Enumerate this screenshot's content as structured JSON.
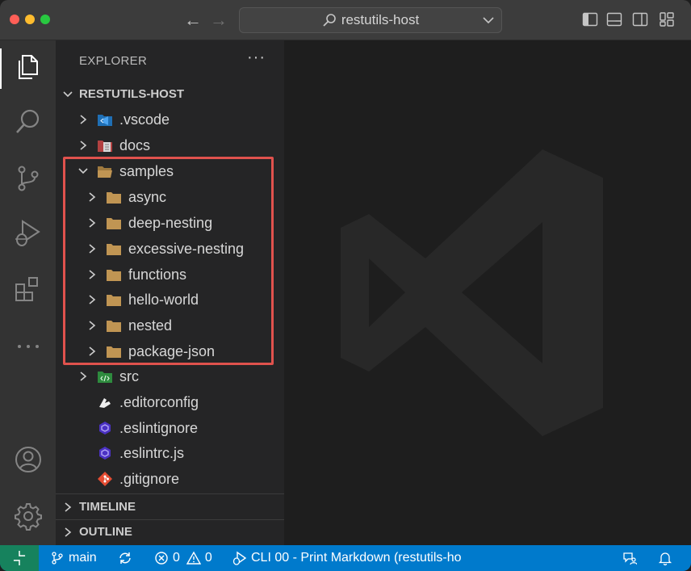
{
  "titlebar": {
    "search_label": "restutils-host"
  },
  "activity_bar": {
    "items": [
      "files-icon",
      "search-icon",
      "source-control-icon",
      "run-debug-icon",
      "extensions-icon",
      "more-icon",
      "account-icon",
      "gear-icon"
    ]
  },
  "explorer": {
    "header": "EXPLORER",
    "more": "···",
    "root_label": "RESTUTILS-HOST",
    "tree": [
      {
        "name": ".vscode",
        "icon": "vscode-folder-icon"
      },
      {
        "name": "docs",
        "icon": "docs-folder-icon"
      },
      {
        "name": "samples",
        "icon": "folder-open-icon",
        "expanded": true
      },
      {
        "name": "async",
        "icon": "folder-icon"
      },
      {
        "name": "deep-nesting",
        "icon": "folder-icon"
      },
      {
        "name": "excessive-nesting",
        "icon": "folder-icon"
      },
      {
        "name": "functions",
        "icon": "folder-icon"
      },
      {
        "name": "hello-world",
        "icon": "folder-icon"
      },
      {
        "name": "nested",
        "icon": "folder-icon"
      },
      {
        "name": "package-json",
        "icon": "folder-icon"
      },
      {
        "name": "src",
        "icon": "src-folder-icon"
      },
      {
        "name": ".editorconfig",
        "icon": "editorconfig-icon"
      },
      {
        "name": ".eslintignore",
        "icon": "eslint-icon"
      },
      {
        "name": ".eslintrc.js",
        "icon": "eslint-icon"
      },
      {
        "name": ".gitignore",
        "icon": "git-icon"
      }
    ],
    "timeline_label": "TIMELINE",
    "outline_label": "OUTLINE"
  },
  "statusbar": {
    "branch": "main",
    "errors": "0",
    "warnings": "0",
    "task": "CLI 00 - Print Markdown (restutils-ho"
  },
  "colors": {
    "accent": "#007acc",
    "remote": "#16825d",
    "highlight": "#e0524d",
    "folder": "#c09553"
  }
}
